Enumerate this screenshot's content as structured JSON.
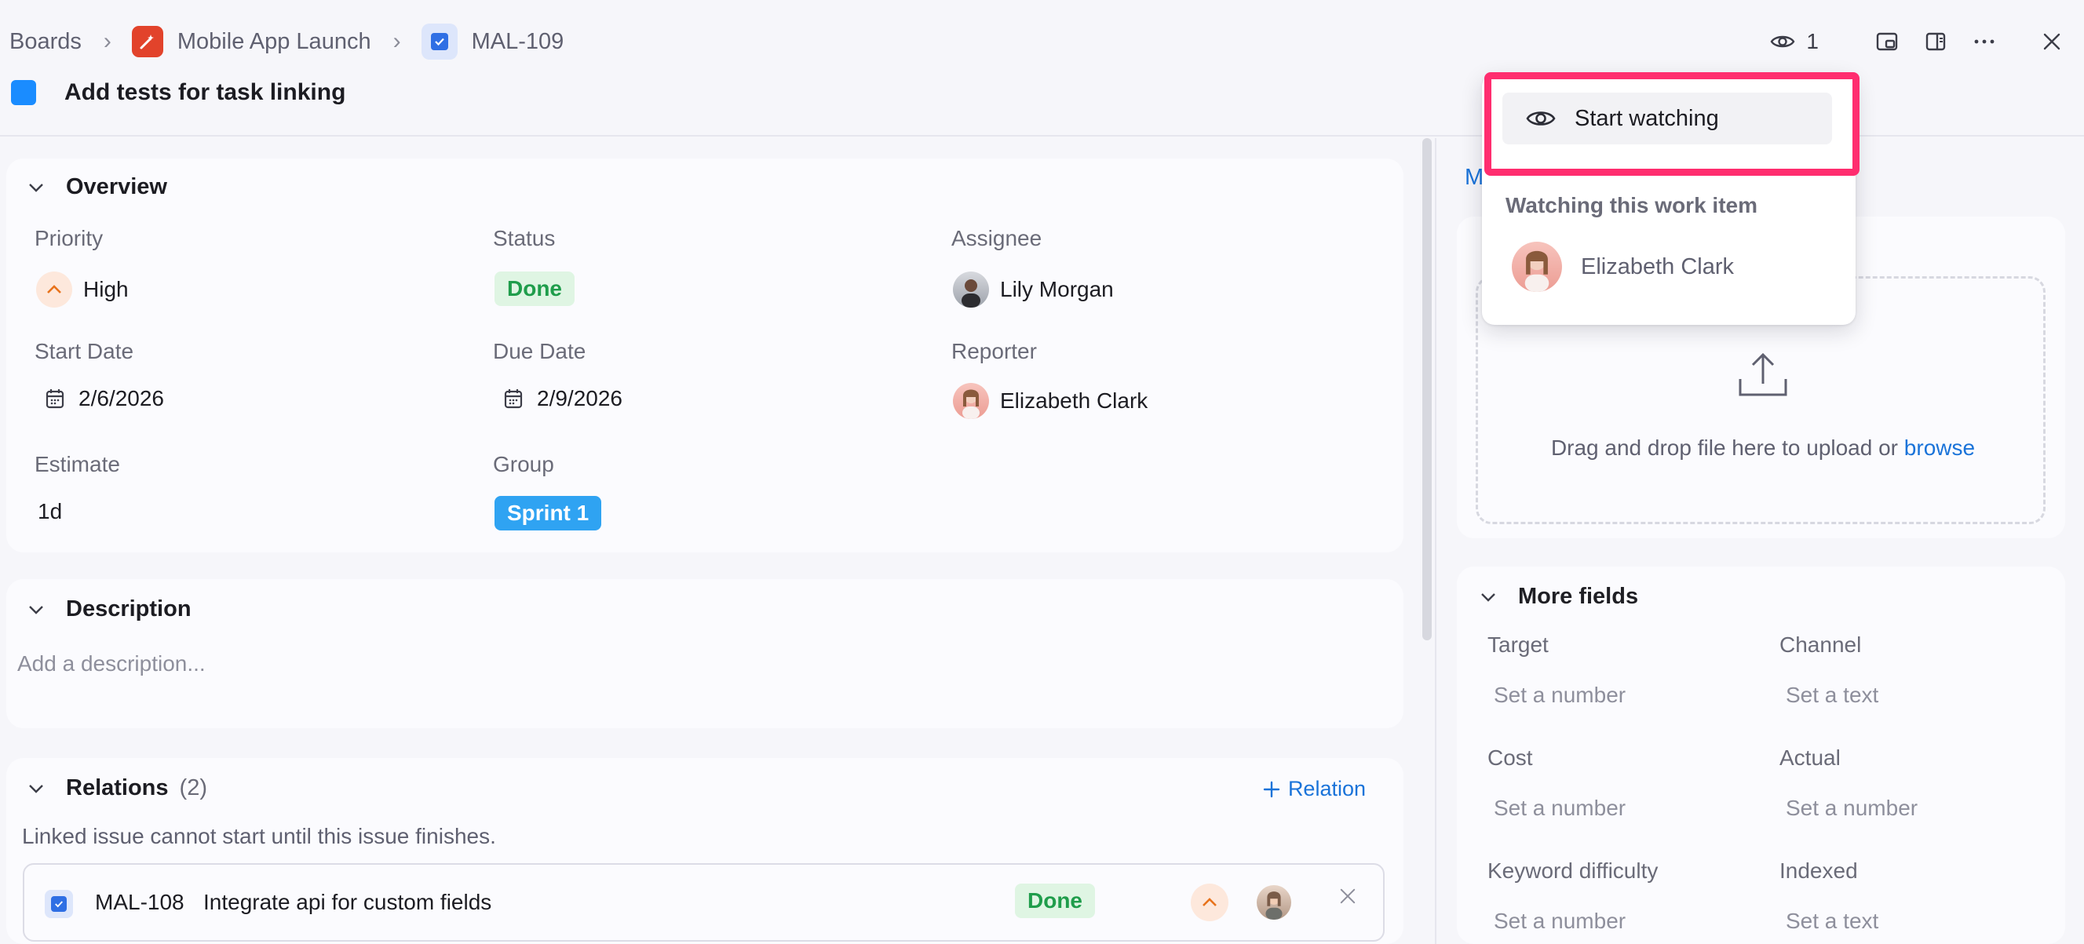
{
  "breadcrumb": {
    "boards": "Boards",
    "project": "Mobile App Launch",
    "item_key": "MAL-109"
  },
  "title": "Add tests for task linking",
  "header_actions": {
    "watch_count": "1"
  },
  "overview": {
    "heading": "Overview",
    "priority_label": "Priority",
    "priority_value": "High",
    "status_label": "Status",
    "status_value": "Done",
    "assignee_label": "Assignee",
    "assignee_value": "Lily Morgan",
    "start_label": "Start Date",
    "start_value": "2/6/2026",
    "due_label": "Due Date",
    "due_value": "2/9/2026",
    "reporter_label": "Reporter",
    "reporter_value": "Elizabeth Clark",
    "estimate_label": "Estimate",
    "estimate_value": "1d",
    "group_label": "Group",
    "group_value": "Sprint 1"
  },
  "description": {
    "heading": "Description",
    "placeholder": "Add a description..."
  },
  "relations": {
    "heading": "Relations",
    "count": "(2)",
    "add_label": "Relation",
    "note": "Linked issue cannot start until this issue finishes.",
    "rows": [
      {
        "key": "MAL-108",
        "title": "Integrate api for custom fields",
        "status": "Done"
      }
    ]
  },
  "right_panel": {
    "partial_link": "M",
    "drop_text": "Drag and drop file here to upload or",
    "drop_link": "browse",
    "more_fields": {
      "heading": "More fields",
      "fields": [
        {
          "label": "Target",
          "value": "Set a number"
        },
        {
          "label": "Channel",
          "value": "Set a text"
        },
        {
          "label": "Cost",
          "value": "Set a number"
        },
        {
          "label": "Actual",
          "value": "Set a number"
        },
        {
          "label": "Keyword difficulty",
          "value": "Set a number"
        },
        {
          "label": "Indexed",
          "value": "Set a text"
        }
      ]
    }
  },
  "watch_popup": {
    "start_watching": "Start watching",
    "watching_label": "Watching this work item",
    "watcher_name": "Elizabeth Clark"
  },
  "colors": {
    "accent": "#1a73d9",
    "status_done": "#1f9d4b",
    "sprint": "#2fa3f2",
    "highlight": "#ff2d6f"
  }
}
